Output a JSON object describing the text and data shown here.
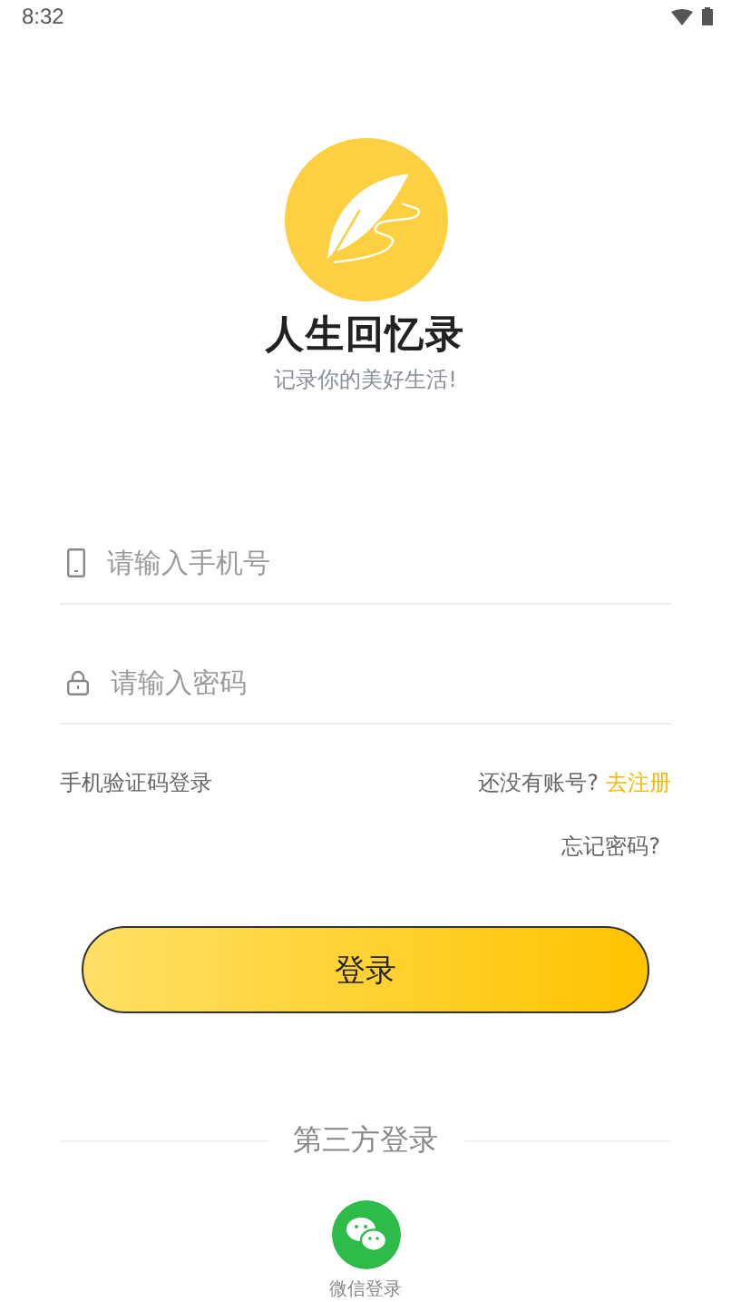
{
  "status_bar": {
    "time": "8:32"
  },
  "app": {
    "name": "人生回忆录",
    "slogan": "记录你的美好生活!"
  },
  "fields": [
    {
      "kind": "phone",
      "placeholder": "请输入手机号"
    },
    {
      "kind": "password",
      "placeholder": "请输入密码"
    }
  ],
  "sms_login": "手机验证码登录",
  "register": {
    "prompt": "还没有账号?",
    "link": "去注册"
  },
  "forgot_password": "忘记密码?",
  "login_button": "登录",
  "third_party": {
    "title": "第三方登录",
    "items": [
      {
        "kind": "wechat",
        "label": "微信登录"
      }
    ]
  }
}
